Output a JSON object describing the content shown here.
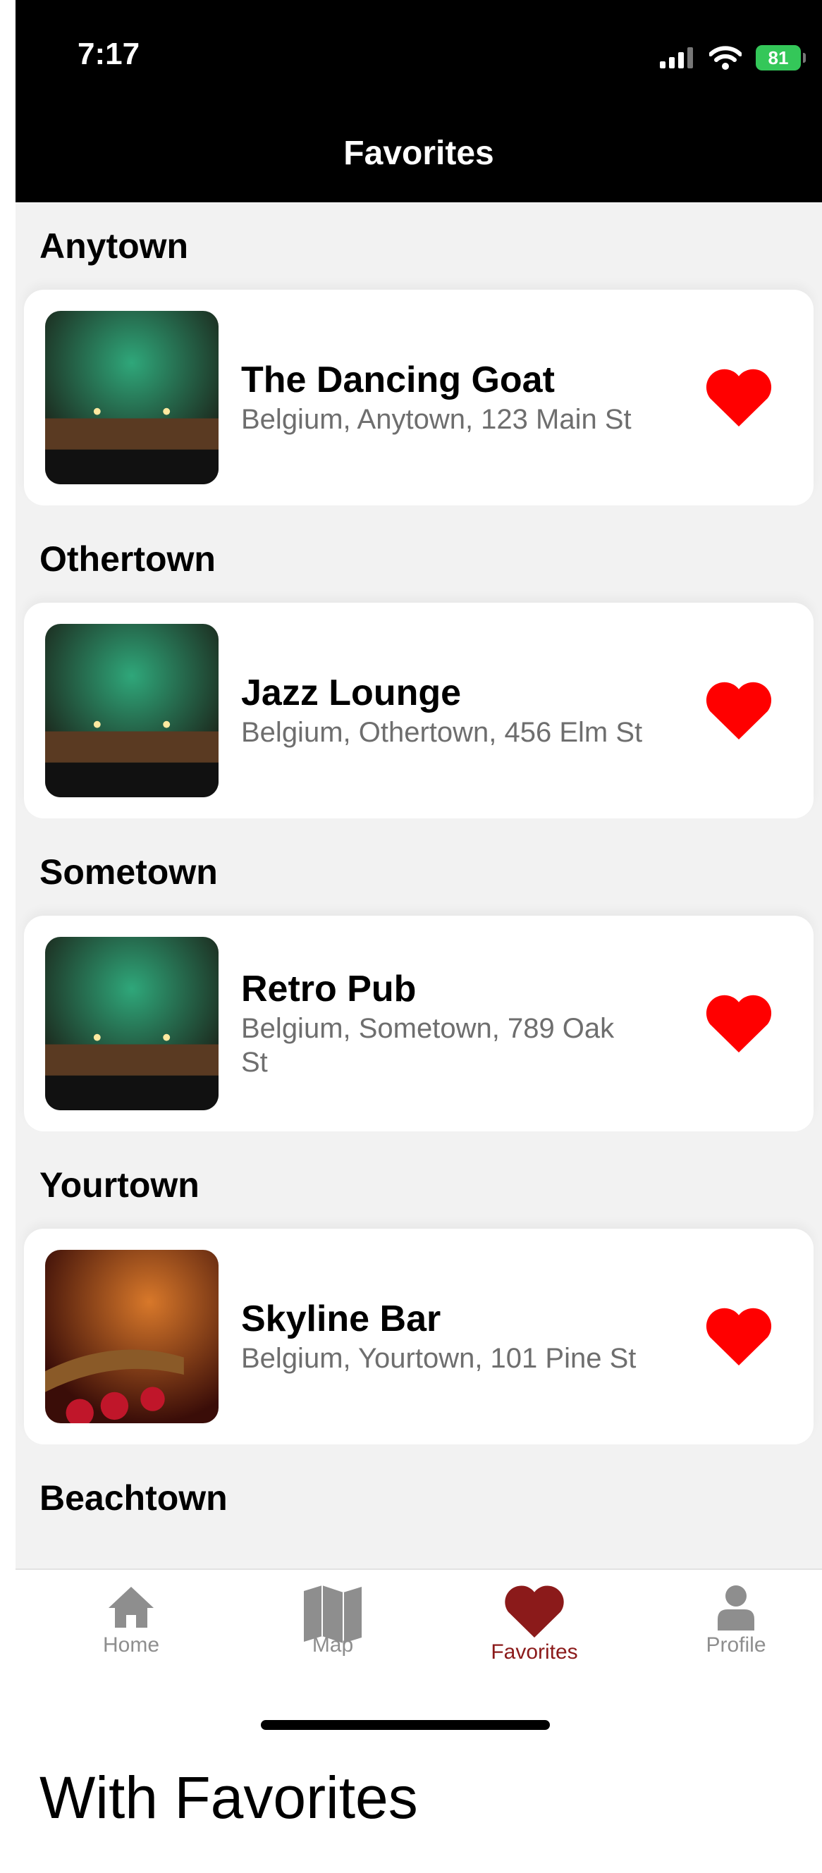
{
  "status_bar": {
    "time": "7:17",
    "battery": "81"
  },
  "nav": {
    "title": "Favorites"
  },
  "sections": [
    {
      "header": "Anytown",
      "item": {
        "name": "The Dancing Goat",
        "address": "Belgium, Anytown, 123 Main St",
        "image": "green-bar-photo"
      }
    },
    {
      "header": "Othertown",
      "item": {
        "name": "Jazz Lounge",
        "address": "Belgium, Othertown, 456 Elm St",
        "image": "green-bar-photo"
      }
    },
    {
      "header": "Sometown",
      "item": {
        "name": "Retro Pub",
        "address": "Belgium, Sometown, 789 Oak St",
        "image": "green-bar-photo"
      }
    },
    {
      "header": "Yourtown",
      "item": {
        "name": "Skyline Bar",
        "address": "Belgium, Yourtown, 101 Pine St",
        "image": "red-lounge-photo"
      }
    },
    {
      "header": "Beachtown"
    }
  ],
  "tabs": [
    {
      "label": "Home",
      "icon": "house-icon"
    },
    {
      "label": "Map",
      "icon": "map-icon"
    },
    {
      "label": "Favorites",
      "icon": "heart-icon",
      "active": true
    },
    {
      "label": "Profile",
      "icon": "person-icon"
    }
  ],
  "caption": "With Favorites",
  "colors": {
    "heart": "#ff0000",
    "active_tab": "#8b1a1a",
    "inactive_tab": "#8e8e8e"
  }
}
